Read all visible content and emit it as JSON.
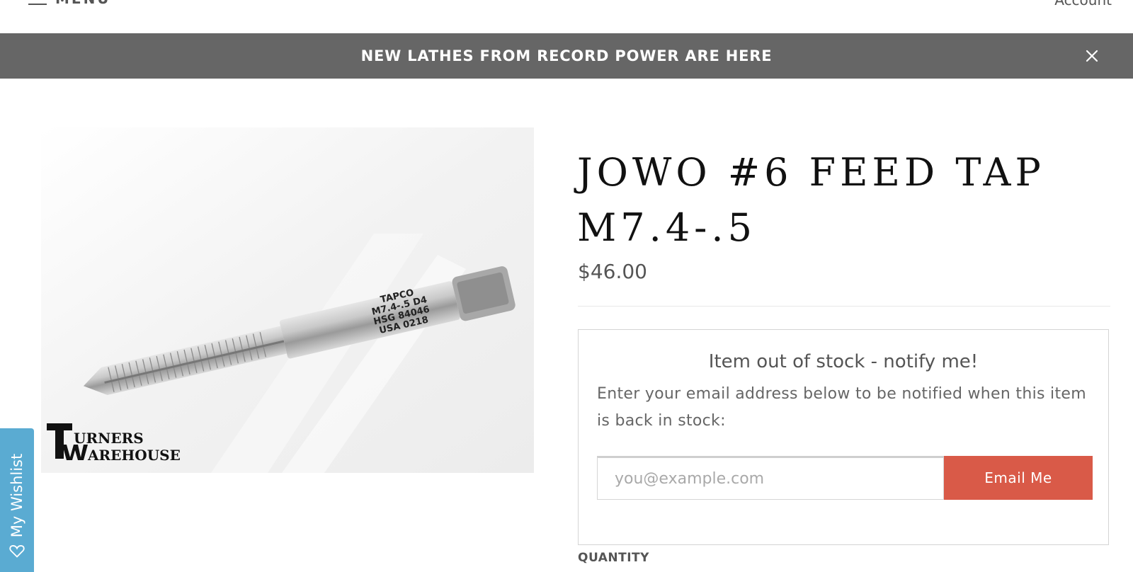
{
  "header": {
    "menu_label": "MENU",
    "account_label": "Account"
  },
  "announcement": {
    "text": "NEW LATHES FROM RECORD POWER ARE HERE",
    "background": "#666666"
  },
  "product": {
    "title": "JOWO #6 FEED TAP M7.4-.5",
    "price": "$46.00",
    "image": {
      "etched_text": [
        "TAPCO",
        "M7.4-.5 D4",
        "HSG 84046",
        "USA 0218"
      ],
      "logo_text": [
        "URNERS",
        "AREHOUSE"
      ]
    }
  },
  "notify": {
    "heading": "Item out of stock - notify me!",
    "text": "Enter your email address below to be notified when this item is back in stock:",
    "email_placeholder": "you@example.com",
    "button_label": "Email Me",
    "button_color": "#d95a48"
  },
  "quantity_label": "QUANTITY",
  "wishlist": {
    "label": "My Wishlist",
    "color": "#5aabd2"
  }
}
